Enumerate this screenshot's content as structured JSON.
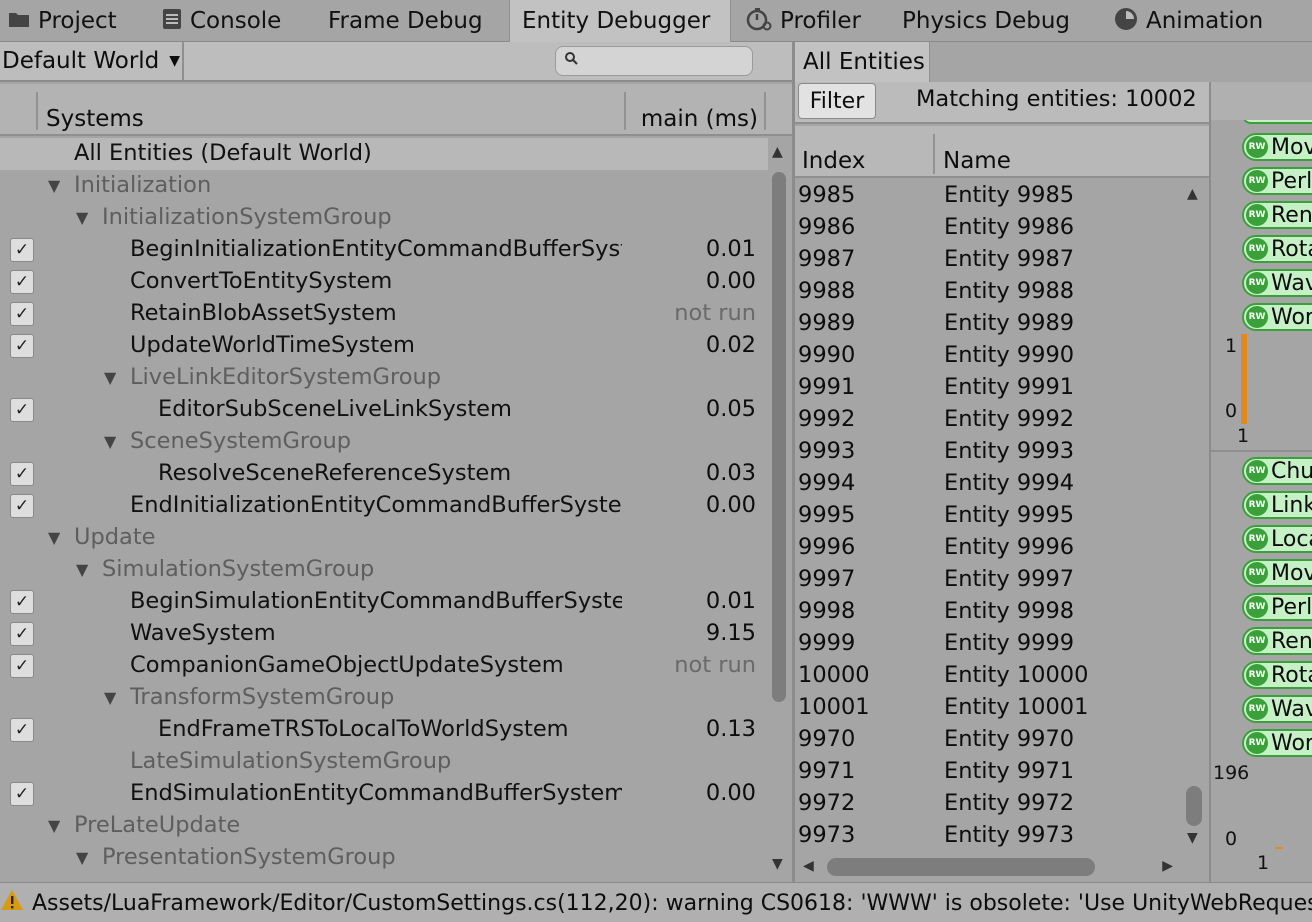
{
  "tabs": [
    {
      "label": "Project",
      "icon": "folder-icon"
    },
    {
      "label": "Console",
      "icon": "console-icon"
    },
    {
      "label": "Frame Debug",
      "icon": ""
    },
    {
      "label": "Entity Debugger",
      "icon": ""
    },
    {
      "label": "Profiler",
      "icon": "stopwatch-icon"
    },
    {
      "label": "Physics Debug",
      "icon": ""
    },
    {
      "label": "Animation",
      "icon": "clock-icon"
    }
  ],
  "world_selector": {
    "value": "Default World"
  },
  "search": {
    "placeholder": ""
  },
  "systems_header": {
    "systems": "Systems",
    "main": "main (ms)"
  },
  "systems": [
    {
      "label": "All Entities (Default World)",
      "selected": true
    },
    {
      "label": "Initialization",
      "group": true
    },
    {
      "label": "InitializationSystemGroup",
      "group": true
    },
    {
      "label": "BeginInitializationEntityCommandBufferSystem",
      "checked": true,
      "value": "0.01"
    },
    {
      "label": "ConvertToEntitySystem",
      "checked": true,
      "value": "0.00"
    },
    {
      "label": "RetainBlobAssetSystem",
      "checked": true,
      "value": "not run"
    },
    {
      "label": "UpdateWorldTimeSystem",
      "checked": true,
      "value": "0.02"
    },
    {
      "label": "LiveLinkEditorSystemGroup",
      "group": true
    },
    {
      "label": "EditorSubSceneLiveLinkSystem",
      "checked": true,
      "value": "0.05"
    },
    {
      "label": "SceneSystemGroup",
      "group": true
    },
    {
      "label": "ResolveSceneReferenceSystem",
      "checked": true,
      "value": "0.03"
    },
    {
      "label": "EndInitializationEntityCommandBufferSystem",
      "checked": true,
      "value": "0.00"
    },
    {
      "label": "Update",
      "group": true
    },
    {
      "label": "SimulationSystemGroup",
      "group": true
    },
    {
      "label": "BeginSimulationEntityCommandBufferSystem",
      "checked": true,
      "value": "0.01"
    },
    {
      "label": "WaveSystem",
      "checked": true,
      "value": "9.15"
    },
    {
      "label": "CompanionGameObjectUpdateSystem",
      "checked": true,
      "value": "not run"
    },
    {
      "label": "TransformSystemGroup",
      "group": true
    },
    {
      "label": "EndFrameTRSToLocalToWorldSystem",
      "checked": true,
      "value": "0.13"
    },
    {
      "label": "LateSimulationSystemGroup",
      "group": true
    },
    {
      "label": "EndSimulationEntityCommandBufferSystem",
      "checked": true,
      "value": "0.00"
    },
    {
      "label": "PreLateUpdate",
      "group": true
    },
    {
      "label": "PresentationSystemGroup",
      "group": true
    }
  ],
  "entities_panel": {
    "tab": "All Entities",
    "filter_label": "Filter",
    "matching": "Matching entities: 10002",
    "col_index": "Index",
    "col_name": "Name",
    "rows": [
      {
        "index": "9985",
        "name": "Entity 9985"
      },
      {
        "index": "9986",
        "name": "Entity 9986"
      },
      {
        "index": "9987",
        "name": "Entity 9987"
      },
      {
        "index": "9988",
        "name": "Entity 9988"
      },
      {
        "index": "9989",
        "name": "Entity 9989"
      },
      {
        "index": "9990",
        "name": "Entity 9990"
      },
      {
        "index": "9991",
        "name": "Entity 9991"
      },
      {
        "index": "9992",
        "name": "Entity 9992"
      },
      {
        "index": "9993",
        "name": "Entity 9993"
      },
      {
        "index": "9994",
        "name": "Entity 9994"
      },
      {
        "index": "9995",
        "name": "Entity 9995"
      },
      {
        "index": "9996",
        "name": "Entity 9996"
      },
      {
        "index": "9997",
        "name": "Entity 9997"
      },
      {
        "index": "9998",
        "name": "Entity 9998"
      },
      {
        "index": "9999",
        "name": "Entity 9999"
      },
      {
        "index": "10000",
        "name": "Entity 10000"
      },
      {
        "index": "10001",
        "name": "Entity 10001"
      },
      {
        "index": "9970",
        "name": "Entity 9970"
      },
      {
        "index": "9971",
        "name": "Entity 9971"
      },
      {
        "index": "9972",
        "name": "Entity 9972"
      },
      {
        "index": "9973",
        "name": "Entity 9973"
      }
    ]
  },
  "chunk_panel": {
    "top_tags": [
      "Mov",
      "Perl",
      "Ren",
      "Rota",
      "Wav",
      "Wor"
    ],
    "axis_1": "1",
    "axis_0": "0",
    "axis_x1": "1",
    "bottom_tags": [
      "Chu",
      "Link",
      "Loca",
      "Mov",
      "Perl",
      "Ren",
      "Rota",
      "Wav",
      "Wor"
    ],
    "count": "196",
    "axis_0b": "0",
    "axis_x1b": "1",
    "tag_badge": "RW"
  },
  "status": {
    "message": "Assets/LuaFramework/Editor/CustomSettings.cs(112,20): warning CS0618: 'WWW' is obsolete: 'Use UnityWebRequest"
  },
  "colors": {
    "panel_bg": "#a5a5a5",
    "component_green": "#3aa13a",
    "component_fill": "#c6f0c6",
    "chart_orange": "#e08a20",
    "warning_yellow": "#d08a00"
  }
}
